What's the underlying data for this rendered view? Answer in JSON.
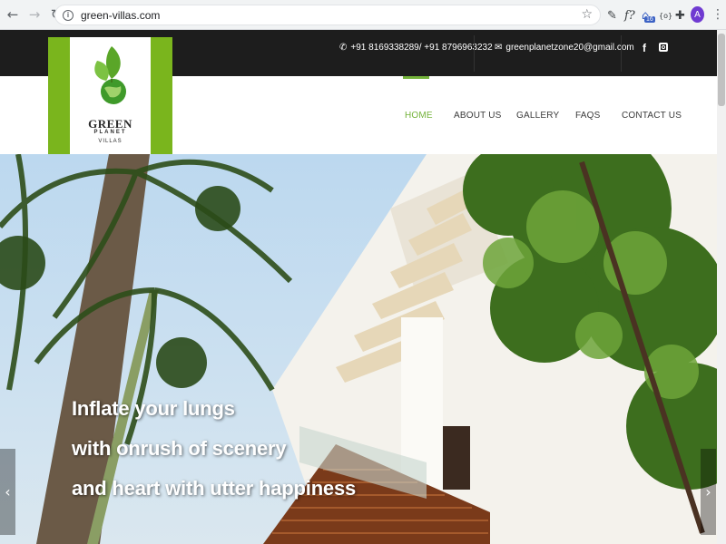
{
  "browser": {
    "url": "green-villas.com",
    "back_icon": "arrow-left-icon",
    "forward_icon": "arrow-right-icon",
    "reload_icon": "reload-icon",
    "avatar_letter": "A",
    "extension_badge": "16"
  },
  "topbar": {
    "phone": "+91 8169338289/ +91 8796963232",
    "email": "greenplanetzone20@gmail.com",
    "social": [
      "f",
      "instagram"
    ]
  },
  "logo": {
    "line1": "GREEN",
    "line2": "PLANET",
    "line3": "VILLAS"
  },
  "nav": {
    "items": [
      "HOME",
      "ABOUT US",
      "GALLERY",
      "FAQS",
      "CONTACT US"
    ],
    "active": "HOME"
  },
  "hero": {
    "lines": [
      "Inflate your lungs",
      "with onrush of scenery",
      "and heart with utter happiness"
    ],
    "prev_label": "‹",
    "next_label": "›"
  },
  "colors": {
    "accent": "#73b239",
    "topbar": "#1d1d1d",
    "logo_green": "#7ab51d"
  }
}
